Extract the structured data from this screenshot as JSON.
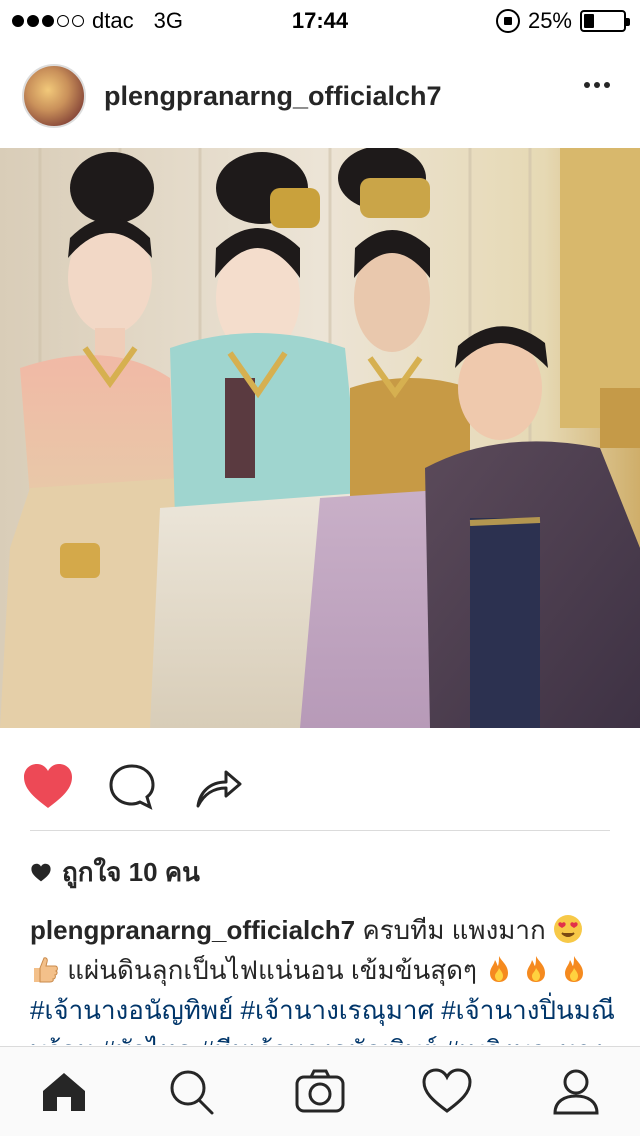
{
  "status_bar": {
    "carrier": "dtac",
    "network": "3G",
    "time": "17:44",
    "battery": "25%",
    "battery_level": 0.25,
    "signal_bars": 3,
    "signal_total": 5
  },
  "post": {
    "username": "plengpranarng_officialch7",
    "likes_text": "ถูกใจ 10 คน",
    "caption": {
      "username": "plengpranarng_officialch7",
      "line1": "ครบทีม แพงมาก",
      "line2": "แผ่นดินลุกเป็นไฟแน่นอน เข้มข้นสุดๆ",
      "hashtags_line1": "#เจ้านางอนัญทิพย์ #เจ้านางเรณุมาศ #เจ้านางปิ่นมณี",
      "hashtags_line2": "พร้อม #บัวไหล #ทีมเจ้านางอนัญทิพย์ #เพลิงพระนาง"
    },
    "liked": true
  },
  "icons": {
    "heart": "heart-filled-icon",
    "comment": "comment-icon",
    "share": "share-icon",
    "more": "more-icon"
  },
  "colors": {
    "like_red": "#ed4956",
    "hashtag_blue": "#003569",
    "text": "#262626"
  },
  "tab_bar": [
    "home",
    "search",
    "camera",
    "activity",
    "profile"
  ]
}
